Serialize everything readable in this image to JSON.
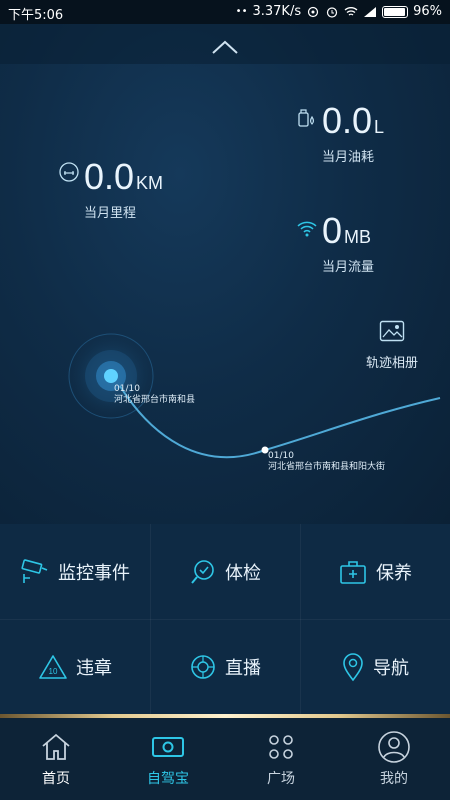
{
  "status_bar": {
    "time": "下午5:06",
    "speed": "3.37K/s",
    "battery": "96%"
  },
  "stats": {
    "mileage": {
      "value": "0.0",
      "unit": "KM",
      "label": "当月里程"
    },
    "fuel": {
      "value": "0.0",
      "unit": "L",
      "label": "当月油耗"
    },
    "data": {
      "value": "0",
      "unit": "MB",
      "label": "当月流量"
    }
  },
  "album": {
    "label": "轨迹相册"
  },
  "track": {
    "start": {
      "date": "01/10",
      "address": "河北省邢台市南和县"
    },
    "end": {
      "date": "01/10",
      "address": "河北省邢台市南和县和阳大街"
    }
  },
  "menu": {
    "items": [
      {
        "label": "监控事件",
        "icon": "camera-monitor-icon"
      },
      {
        "label": "体检",
        "icon": "check-magnifier-icon"
      },
      {
        "label": "保养",
        "icon": "toolbox-icon"
      },
      {
        "label": "违章",
        "icon": "violation-triangle-icon"
      },
      {
        "label": "直播",
        "icon": "camera-aperture-icon"
      },
      {
        "label": "导航",
        "icon": "location-pin-icon"
      }
    ],
    "violation_badge": "10"
  },
  "tabs": [
    {
      "label": "首页",
      "icon": "home-icon"
    },
    {
      "label": "自驾宝",
      "icon": "dashcam-icon"
    },
    {
      "label": "广场",
      "icon": "grid-dots-icon"
    },
    {
      "label": "我的",
      "icon": "user-icon"
    }
  ],
  "colors": {
    "accent": "#2ec6e6",
    "background": "#0b2236",
    "gold": "#e2c98f"
  }
}
